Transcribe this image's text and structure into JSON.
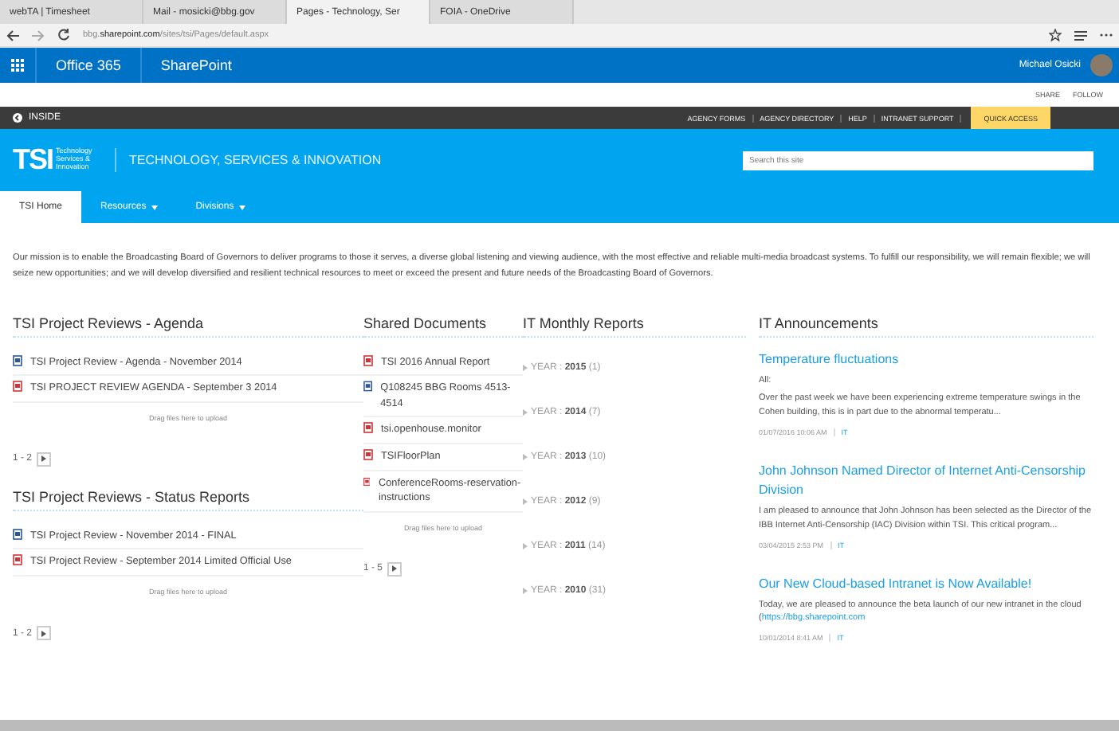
{
  "browser": {
    "tabs": [
      {
        "title": "webTA | Timesheet",
        "selected": false
      },
      {
        "title": "Mail - mosicki@bbg.gov",
        "selected": false
      },
      {
        "title": "Pages - Technology, Ser",
        "selected": true
      },
      {
        "title": "FOIA - OneDrive",
        "selected": false
      }
    ],
    "address": "bbg.**sharepoint.com**/sites/tsi/Pages/default.aspx"
  },
  "suite_bar": {
    "app": "Office 365",
    "site": "SharePoint",
    "user": "Michael Osicki"
  },
  "page_actions": [
    "SHARE",
    "FOLLOW"
  ],
  "top_bar": {
    "brand": "INSIDE",
    "links": [
      "AGENCY FORMS",
      "AGENCY DIRECTORY",
      "HELP",
      "INTRANET SUPPORT"
    ],
    "quick_access": "QUICK ACCESS"
  },
  "header": {
    "logo": "TSI",
    "logo_subtitle": "Technology Services & Innovation",
    "title": "TECHNOLOGY, SERVICES & INNOVATION",
    "search": {
      "placeholder": "Search this site"
    }
  },
  "nav": [
    {
      "label": "TSI Home",
      "selected": true,
      "dropdown": false
    },
    {
      "label": "Resources",
      "selected": false,
      "dropdown": true
    },
    {
      "label": "Divisions",
      "selected": false,
      "dropdown": true
    }
  ],
  "mission": "Our mission is to enable the Broadcasting Board of Governors to deliver programs to those it serves, a diverse global listening and viewing audience, with the most effective and reliable multi-media broadcast systems. To fulfill our responsibility, we will remain flexible; we will seize new opportunities; and we will develop diversified and resilient technical resources to meet or exceed the present and future needs of the Broadcasting Board of Governors.",
  "agenda": {
    "title": "TSI Project Reviews - Agenda",
    "items": [
      {
        "title": "TSI Project Review - Agenda - November 2014",
        "kind": "word"
      },
      {
        "title": "TSI PROJECT REVIEW AGENDA - September 3 2014",
        "kind": "pdf"
      }
    ],
    "drop_hint": "Drag files here to upload",
    "pager": "1 - 2"
  },
  "status_reports": {
    "title": "TSI Project Reviews - Status Reports",
    "items": [
      {
        "title": "TSI Project Review - November 2014 - FINAL",
        "kind": "word"
      },
      {
        "title": "TSI Project Review - September 2014 Limited Official Use",
        "kind": "pdf"
      }
    ],
    "drop_hint": "Drag files here to upload",
    "pager": "1 - 2"
  },
  "shared_documents": {
    "title": "Shared Documents",
    "items": [
      {
        "title": "TSI 2016 Annual Report",
        "kind": "pdf"
      },
      {
        "title": "Q108245 BBG Rooms 4513-4514",
        "kind": "word"
      },
      {
        "title": "tsi.openhouse.monitor",
        "kind": "pdf"
      },
      {
        "title": "TSIFloorPlan",
        "kind": "pdf"
      },
      {
        "title": "ConferenceRooms-reservation-instructions",
        "kind": "pdf"
      }
    ],
    "drop_hint": "Drag files here to upload",
    "pager": "1 - 5"
  },
  "monthly_reports": {
    "title": "IT Monthly Reports",
    "groups": [
      "YEAR : **2015** (1)",
      "YEAR : **2014** (7)",
      "YEAR : **2013** (10)",
      "YEAR : **2012** (9)",
      "YEAR : **2011** (14)",
      "YEAR : **2010** (31)"
    ]
  },
  "announcements": {
    "title": "IT Announcements",
    "items": [
      {
        "title": "Temperature fluctuations",
        "body": [
          "All:",
          "Over the past week we have been experiencing extreme temperature swings in the Cohen building, this is in part due to the abnormal temperatu..."
        ],
        "date": "01/07/2016 10:06 AM",
        "category": "IT"
      },
      {
        "title": "John Johnson Named Director of Internet Anti-Censorship Division",
        "body": [
          "I am pleased to announce that John Johnson has been selected as the Director of the IBB Internet Anti-Censorship (IAC) Division within TSI. This critical program..."
        ],
        "date": "03/04/2015 2:53 PM",
        "category": "IT"
      },
      {
        "title": "Our New Cloud-based Intranet is Now Available!",
        "body": [
          "Today, we are pleased to announce the beta launch of our new intranet in the cloud ("
        ],
        "link": "https://bbg.sharepoint.com",
        "date": "10/01/2014 8:41 AM",
        "category": "IT"
      }
    ]
  }
}
